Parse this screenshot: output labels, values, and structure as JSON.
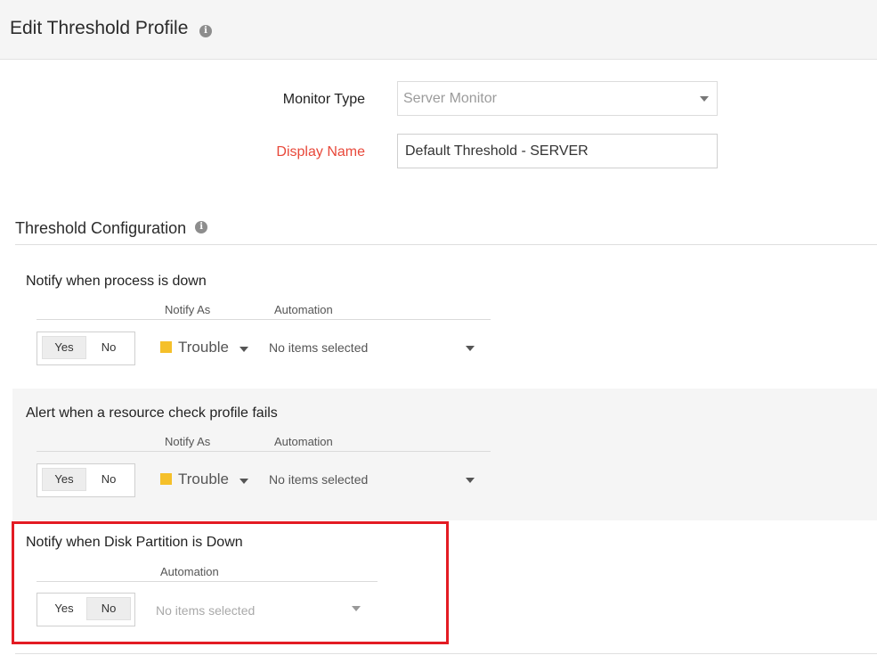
{
  "header": {
    "title": "Edit Threshold Profile",
    "info_icon": "info-icon"
  },
  "form": {
    "monitor_type": {
      "label": "Monitor Type",
      "value": "Server Monitor"
    },
    "display_name": {
      "label": "Display Name",
      "value": "Default Threshold - SERVER"
    }
  },
  "section": {
    "title": "Threshold Configuration"
  },
  "columns": {
    "notify_as": "Notify As",
    "automation": "Automation"
  },
  "toggle": {
    "yes": "Yes",
    "no": "No"
  },
  "rules": [
    {
      "title": "Notify when process is down",
      "enabled": "Yes",
      "severity": "Trouble",
      "automation": "No items selected"
    },
    {
      "title": "Alert when a resource check profile fails",
      "enabled": "Yes",
      "severity": "Trouble",
      "automation": "No items selected"
    },
    {
      "title": "Notify when Disk Partition is Down",
      "enabled": "No",
      "automation": "No items selected"
    }
  ],
  "colors": {
    "trouble": "#f5c02a",
    "required_label": "#e8483a",
    "highlight": "#e31b23"
  }
}
